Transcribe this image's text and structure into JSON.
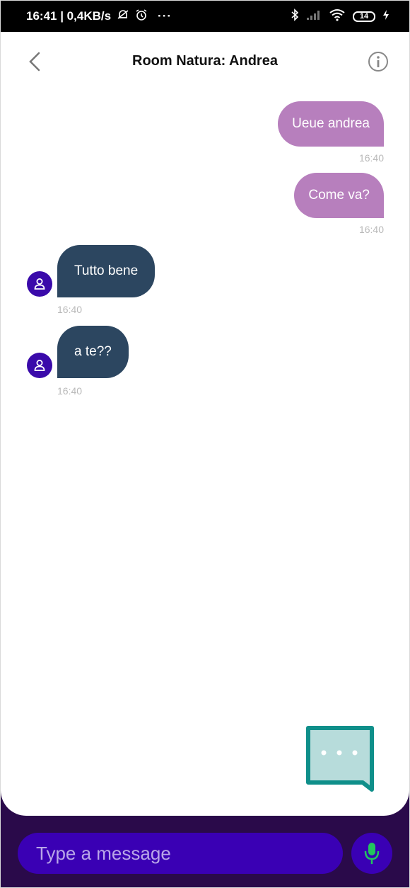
{
  "status_bar": {
    "time_and_speed": "16:41 | 0,4KB/s",
    "more": "···",
    "battery": "14"
  },
  "header": {
    "title": "Room Natura: Andrea"
  },
  "messages": [
    {
      "direction": "outgoing",
      "text": "Ueue andrea",
      "time": "16:40"
    },
    {
      "direction": "outgoing",
      "text": "Come va?",
      "time": "16:40"
    },
    {
      "direction": "incoming",
      "text": "Tutto bene",
      "time": "16:40"
    },
    {
      "direction": "incoming",
      "text": "a te??",
      "time": "16:40"
    }
  ],
  "composer": {
    "placeholder": "Type a message"
  },
  "colors": {
    "outgoing_bubble": "#b77fbd",
    "incoming_bubble": "#2c4660",
    "avatar": "#3a0aaa",
    "composer": "#3a00b4",
    "mic_icon": "#22c55e",
    "typing_indicator": "#0f8f8a"
  },
  "icons": [
    "back-arrow-icon",
    "info-icon",
    "person-icon",
    "mic-icon",
    "typing-indicator-icon",
    "mute-bell-icon",
    "alarm-icon",
    "bluetooth-icon",
    "signal-icon",
    "wifi-icon",
    "battery-icon",
    "charging-icon"
  ]
}
